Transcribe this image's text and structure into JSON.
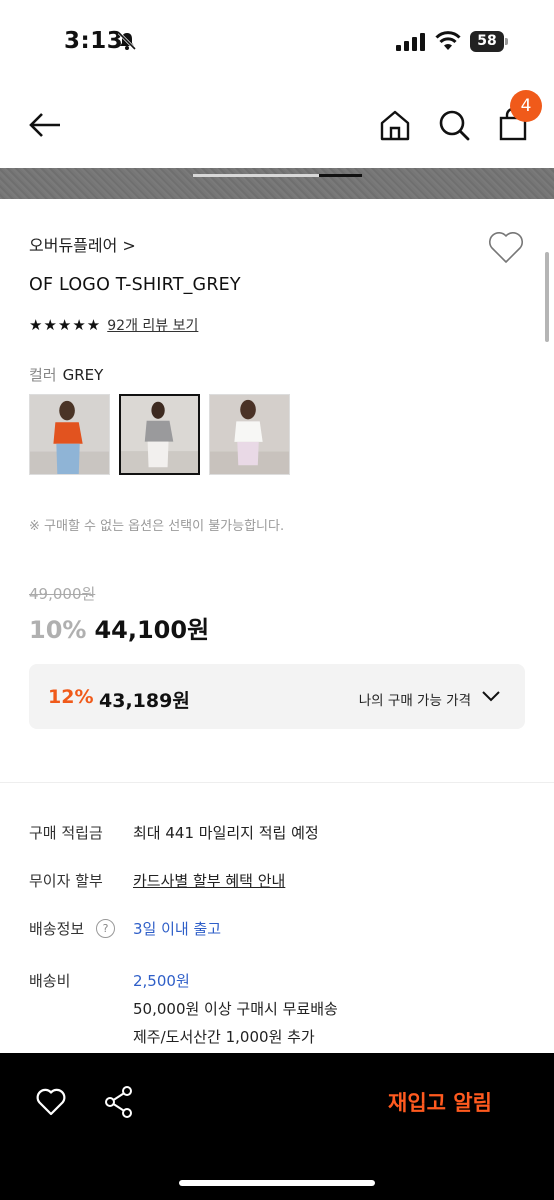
{
  "status_bar": {
    "time": "3:13",
    "battery": "58"
  },
  "nav": {
    "cart_count": "4"
  },
  "product": {
    "brand": "오버듀플레어 >",
    "title": "OF LOGO T-SHIRT_GREY",
    "rating_stars": 5,
    "review_link": "92개 리뷰 보기",
    "color_label": "컬러",
    "color_value": "GREY",
    "swatches": [
      {
        "name": "orange",
        "selected": false
      },
      {
        "name": "grey",
        "selected": true
      },
      {
        "name": "white",
        "selected": false
      }
    ],
    "notice": "※ 구매할 수 없는 옵션은 선택이 불가능합니다."
  },
  "price": {
    "original": "49,000원",
    "discount_rate": "10%",
    "sale_price": "44,100원",
    "my_rate": "12%",
    "my_price": "43,189원",
    "my_label": "나의 구매 가능 가격"
  },
  "info": {
    "points_label": "구매 적립금",
    "points_value": "최대 441 마일리지 적립 예정",
    "installment_label": "무이자 할부",
    "installment_value": "카드사별 할부 혜택 안내",
    "shipping_label": "배송정보",
    "shipping_help": "?",
    "shipping_value": "3일 이내 출고",
    "fee_label": "배송비",
    "fee_value": "2,500원",
    "fee_line2": "50,000원 이상 구매시 무료배송",
    "fee_line3": "제주/도서산간 1,000원 추가"
  },
  "bottom": {
    "restock": "재입고 알림"
  },
  "colors": {
    "accent": "#f05a1a",
    "link_blue": "#2f5fc8",
    "bottom_bar": "#000000"
  },
  "icons": [
    "back-arrow-icon",
    "home-icon",
    "search-icon",
    "bag-icon",
    "heart-icon",
    "share-icon",
    "chevron-down-icon",
    "help-icon"
  ]
}
